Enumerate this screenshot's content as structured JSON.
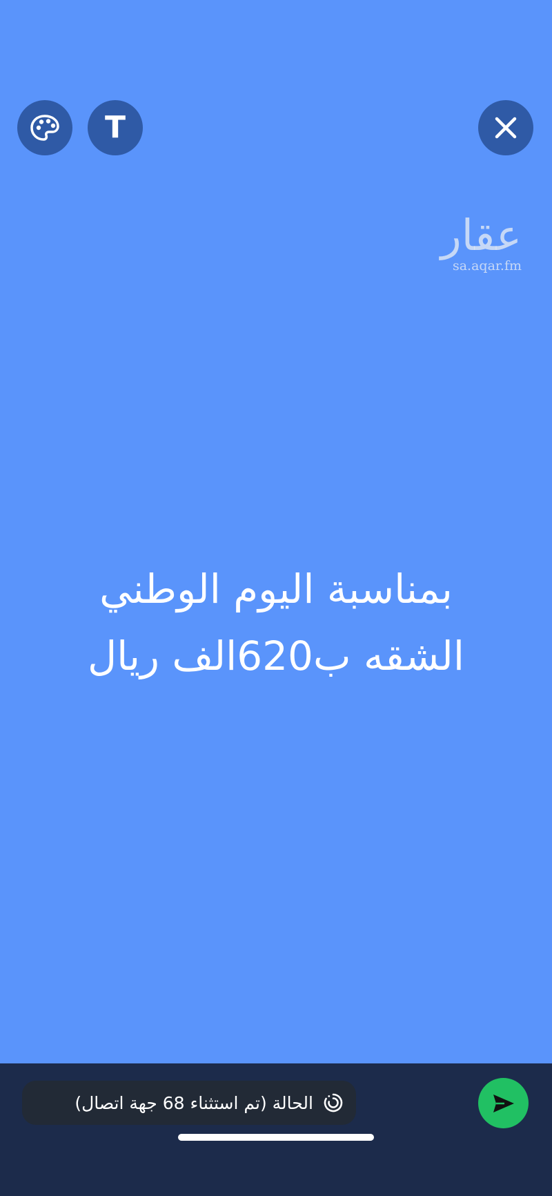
{
  "canvas": {
    "background_color": "#5a94fb",
    "status_lines": [
      "بمناسبة اليوم الوطني",
      "الشقه ب620الف ريال"
    ]
  },
  "toolbar": {
    "palette_icon": "palette-icon",
    "text_button_label": "T",
    "close_icon": "close-icon"
  },
  "watermark": {
    "logo_text": "عقار",
    "url": "sa.aqar.fm"
  },
  "composer": {
    "status_label": "الحالة (تم استثناء 68 جهة اتصال)",
    "status_icon": "status-ring-icon",
    "send_icon": "send-icon",
    "send_color": "#21c063",
    "bar_color": "#1c2b4b"
  }
}
